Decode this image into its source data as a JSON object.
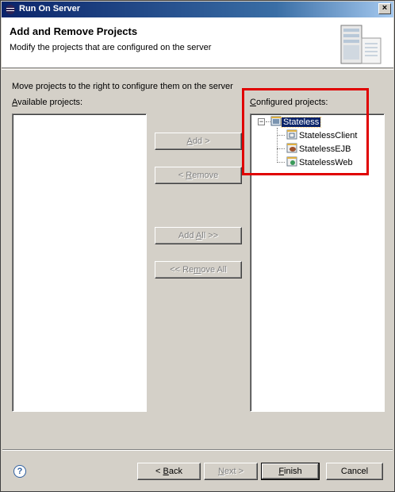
{
  "window": {
    "title": "Run On Server"
  },
  "banner": {
    "title": "Add and Remove Projects",
    "description": "Modify the projects that are configured on the server"
  },
  "instructions": "Move projects to the right to configure them on the server",
  "available": {
    "label_prefix": "",
    "label_mnemonic": "A",
    "label_rest": "vailable projects:",
    "items": []
  },
  "configured": {
    "label_mnemonic": "C",
    "label_rest": "onfigured projects:",
    "tree": {
      "root": "Stateless",
      "children": [
        "StatelessClient",
        "StatelessEJB",
        "StatelessWeb"
      ]
    }
  },
  "buttons": {
    "add": {
      "pre": "",
      "mn": "A",
      "post": "dd >"
    },
    "remove": {
      "pre": "< ",
      "mn": "R",
      "post": "emove"
    },
    "add_all": {
      "pre": "Add ",
      "mn": "A",
      "post": "ll >>"
    },
    "remove_all": {
      "pre": "<< Re",
      "mn": "m",
      "post": "ove All"
    },
    "back": {
      "pre": "< ",
      "mn": "B",
      "post": "ack"
    },
    "next": {
      "pre": "",
      "mn": "N",
      "post": "ext >"
    },
    "finish": {
      "pre": "",
      "mn": "F",
      "post": "inish"
    },
    "cancel": {
      "pre": "Cancel",
      "mn": "",
      "post": ""
    }
  },
  "help_glyph": "?",
  "close_glyph": "×"
}
